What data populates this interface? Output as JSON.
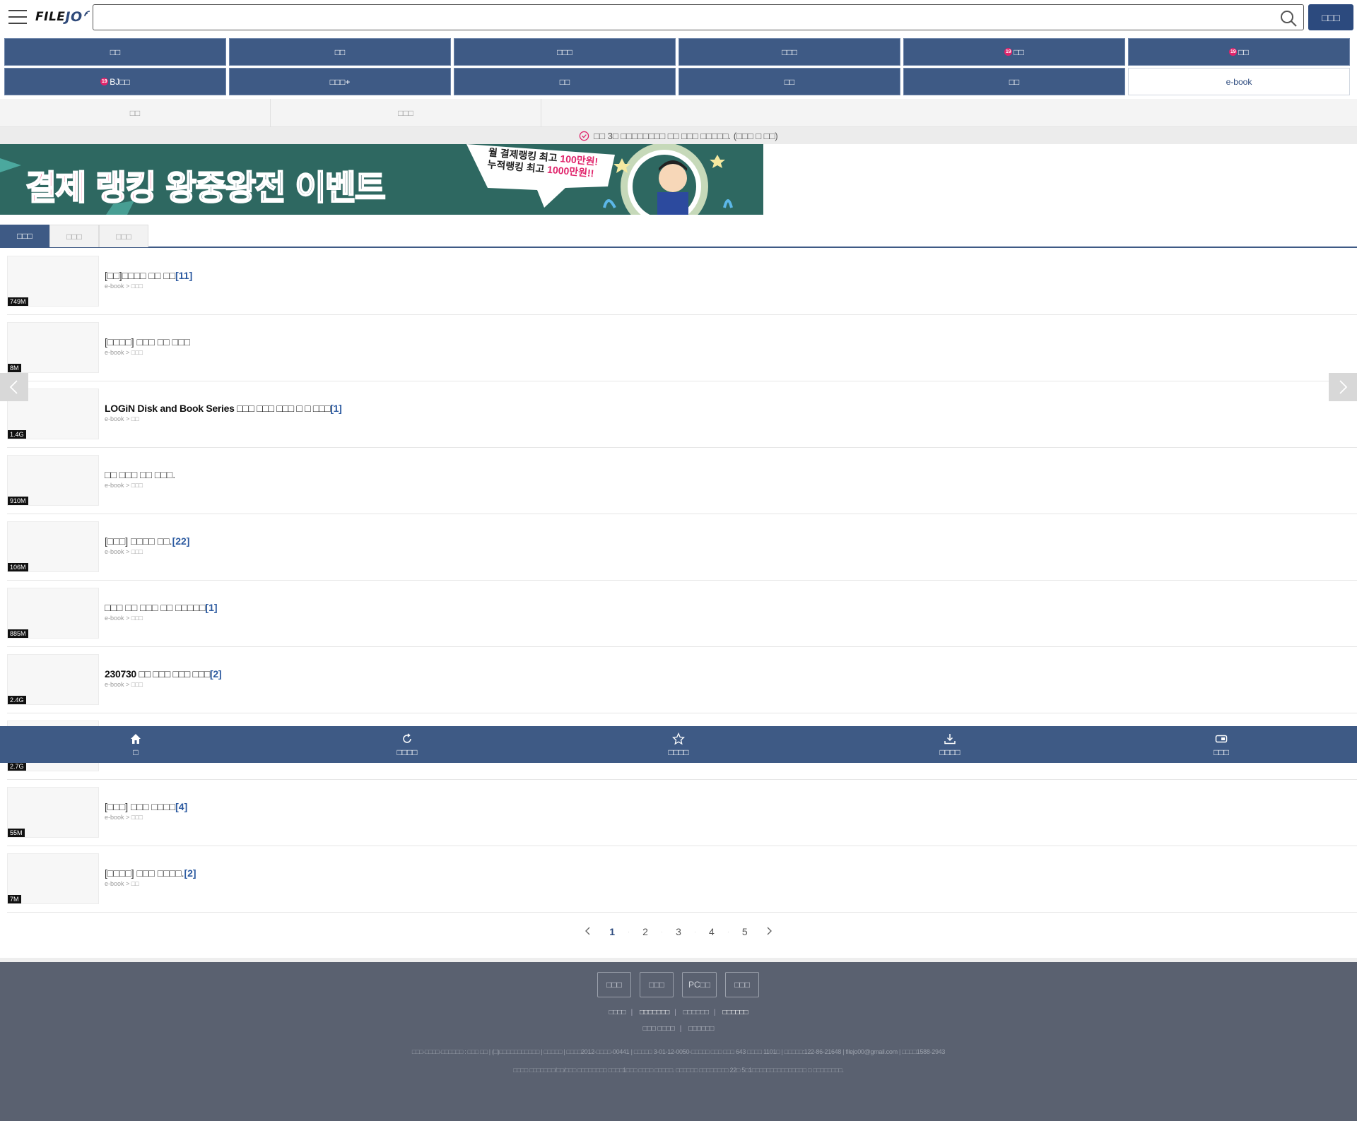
{
  "header": {
    "logo_main": "FILE",
    "logo_sub": "JO",
    "search_placeholder": "",
    "search_button": "□□□"
  },
  "categories": [
    {
      "label": "□□",
      "adult": false,
      "active": false
    },
    {
      "label": "□□",
      "adult": false,
      "active": false
    },
    {
      "label": "□□□",
      "adult": false,
      "active": false
    },
    {
      "label": "□□□",
      "adult": false,
      "active": false
    },
    {
      "label": "□□",
      "adult": true,
      "active": false
    },
    {
      "label": "□□",
      "adult": true,
      "active": false
    },
    {
      "label": "BJ□□",
      "adult": true,
      "active": false
    },
    {
      "label": "□□□+",
      "adult": false,
      "active": false
    },
    {
      "label": "□□",
      "adult": false,
      "active": false
    },
    {
      "label": "□□",
      "adult": false,
      "active": false
    },
    {
      "label": "□□",
      "adult": false,
      "active": false
    },
    {
      "label": "e-book",
      "adult": false,
      "active": true
    }
  ],
  "adult_badge": "19",
  "subtabs": [
    "□□",
    "□□□"
  ],
  "notice": "□□ 3□ □□□□□□□□ □□ □□□ □□□□□. (□□□ □ □□)",
  "banner": {
    "title_part1": "결제 랭킹",
    "title_part2": "왕중왕전 이벤트",
    "bubble_line1": "월 결제랭킹 최고 ",
    "bubble_line1_hl": "100만원!",
    "bubble_line2": "누적랭킹 최고 ",
    "bubble_line2_hl": "1000만원!!"
  },
  "list_tabs": [
    "□□□",
    "□□□",
    "□□□"
  ],
  "items": [
    {
      "title": "[□□]□□□□ □□ □□",
      "count": "[11]",
      "path": "e-book > □□□",
      "size": "749M",
      "bold": false
    },
    {
      "title": "[□□□□] □□□ □□ □□□",
      "count": "",
      "path": "e-book > □□□",
      "size": "8M",
      "bold": false
    },
    {
      "title": "LOGiN Disk and Book Series □□□ □□□ □□□ □ □ □□□",
      "count": "[1]",
      "path": "e-book > □□",
      "size": "1.4G",
      "bold": true
    },
    {
      "title": "□□ □□□ □□ □□□.",
      "count": "",
      "path": "e-book > □□□",
      "size": "910M",
      "bold": false
    },
    {
      "title": "[□□□] □□□□ □□.",
      "count": "[22]",
      "path": "e-book > □□□",
      "size": "106M",
      "bold": false
    },
    {
      "title": "□□□ □□ □□□ □□ □□□□□",
      "count": "[1]",
      "path": "e-book > □□□",
      "size": "885M",
      "bold": false
    },
    {
      "title": "230730 □□ □□□ □□□ □□□",
      "count": "[2]",
      "path": "e-book > □□□",
      "size": "2.4G",
      "bold": true
    },
    {
      "title": "",
      "count": "",
      "path": "",
      "size": "2.7G",
      "bold": false
    },
    {
      "title": "[□□□] □□□ □□□□",
      "count": "[4]",
      "path": "e-book > □□□",
      "size": "55M",
      "bold": false
    },
    {
      "title": "[□□□□] □□□ □□□□.",
      "count": "[2]",
      "path": "e-book > □□",
      "size": "7M",
      "bold": false
    }
  ],
  "bottom_nav": [
    {
      "label": "□",
      "icon": "home-icon"
    },
    {
      "label": "□□□□",
      "icon": "refresh-icon"
    },
    {
      "label": "□□□□",
      "icon": "star-icon"
    },
    {
      "label": "□□□□",
      "icon": "download-icon"
    },
    {
      "label": "□□□",
      "icon": "coupon-icon"
    }
  ],
  "pagination": {
    "pages": [
      "1",
      "2",
      "3",
      "4",
      "5"
    ],
    "current": "1"
  },
  "footer": {
    "buttons": [
      "□□□",
      "□□□",
      "PC□□",
      "□□□"
    ],
    "links_row1": [
      {
        "label": "□□□□",
        "strong": false
      },
      {
        "label": "□□□□□□□",
        "strong": true
      },
      {
        "label": "□□□□□□",
        "strong": false
      },
      {
        "label": "□□□□□□",
        "strong": true
      }
    ],
    "links_row2": [
      "□□□ □□□□",
      "□□□□□□"
    ],
    "info_line1": "□□□-□□□□-□□□□□□ : □□□ □□  |  (□)□□□□□□□□□□□  |  □□□□□  |  □□□□2012-□□□□-00441  |  □□□□□ 3-01-12-0050-□□□□□ □□□ □□□ 643 □□□□ 1101□  |  □□□□□:122-86-21648  |  filejo00@gmail.com  |  □□□□1588-2943",
    "info_line2": "□□□□ □□□□□□□/□□/□□□ □□□□□□□□ □□□□1□□□ □□□□ □□□□□. □□□□□□ □□□□□□□□ 22□ 5□1□□□□□□□□□□□□□□□ □ □□□□□□□□."
  }
}
